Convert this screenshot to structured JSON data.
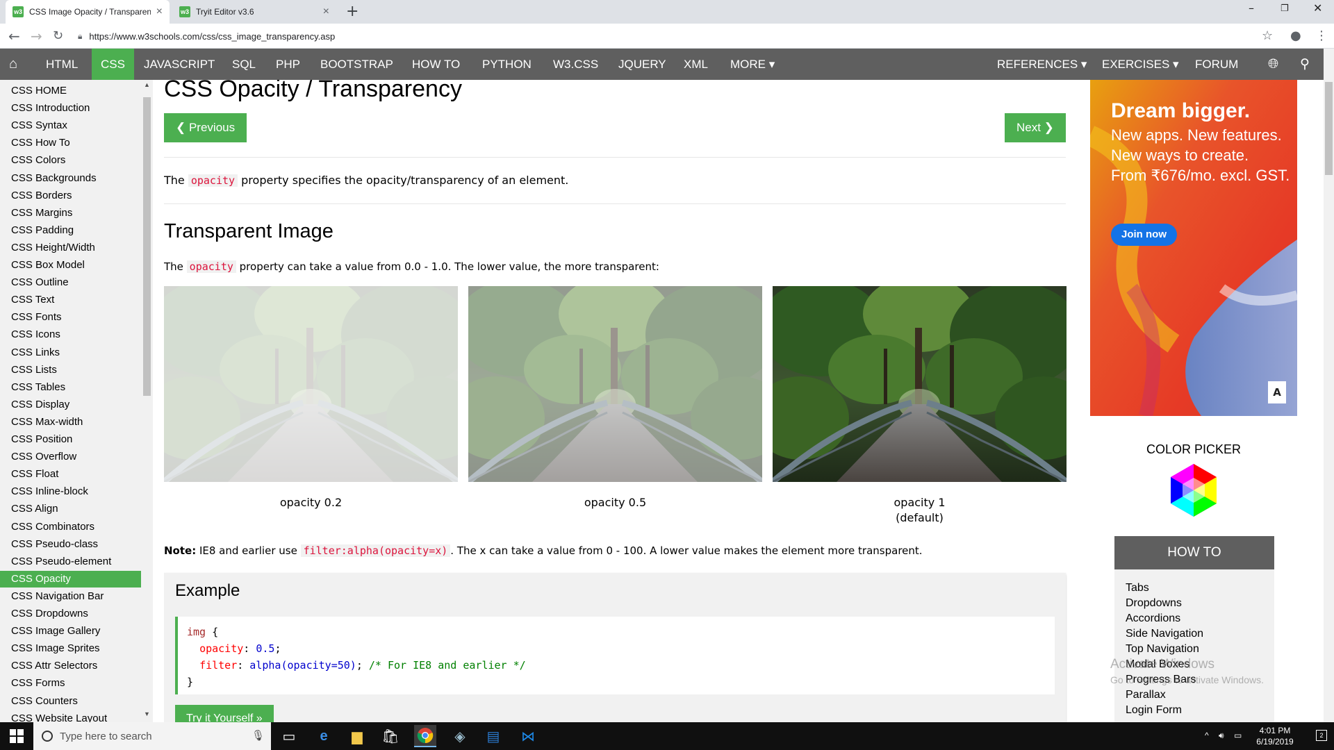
{
  "browser": {
    "tabs": [
      {
        "title": "CSS Image Opacity / Transparency",
        "favicon": "w3"
      },
      {
        "title": "Tryit Editor v3.6",
        "favicon": "w3"
      }
    ],
    "url": "https://www.w3schools.com/css/css_image_transparency.asp"
  },
  "w3nav": {
    "items": [
      "HTML",
      "CSS",
      "JAVASCRIPT",
      "SQL",
      "PHP",
      "BOOTSTRAP",
      "HOW TO",
      "PYTHON",
      "W3.CSS",
      "JQUERY",
      "XML",
      "MORE ▾"
    ],
    "right_items": [
      "REFERENCES ▾",
      "EXERCISES ▾",
      "FORUM"
    ],
    "active": "CSS",
    "accent": "#4caf50"
  },
  "sidebar": {
    "items": [
      "CSS HOME",
      "CSS Introduction",
      "CSS Syntax",
      "CSS How To",
      "CSS Colors",
      "CSS Backgrounds",
      "CSS Borders",
      "CSS Margins",
      "CSS Padding",
      "CSS Height/Width",
      "CSS Box Model",
      "CSS Outline",
      "CSS Text",
      "CSS Fonts",
      "CSS Icons",
      "CSS Links",
      "CSS Lists",
      "CSS Tables",
      "CSS Display",
      "CSS Max-width",
      "CSS Position",
      "CSS Overflow",
      "CSS Float",
      "CSS Inline-block",
      "CSS Align",
      "CSS Combinators",
      "CSS Pseudo-class",
      "CSS Pseudo-element",
      "CSS Opacity",
      "CSS Navigation Bar",
      "CSS Dropdowns",
      "CSS Image Gallery",
      "CSS Image Sprites",
      "CSS Attr Selectors",
      "CSS Forms",
      "CSS Counters",
      "CSS Website Layout"
    ],
    "active": "CSS Opacity"
  },
  "main": {
    "title": "CSS Opacity / Transparency",
    "prev_label": "❮ Previous",
    "next_label": "Next ❯",
    "intro": {
      "before": "The ",
      "code": "opacity",
      "after": " property specifies the opacity/transparency of an element."
    },
    "section_title": "Transparent Image",
    "section_text": {
      "before": "The ",
      "code": "opacity",
      "after": " property can take a value from 0.0 - 1.0. The lower value, the more transparent:"
    },
    "images": [
      {
        "opacity": 0.2,
        "caption": "opacity 0.2",
        "caption2": ""
      },
      {
        "opacity": 0.5,
        "caption": "opacity 0.5",
        "caption2": ""
      },
      {
        "opacity": 1,
        "caption": "opacity 1",
        "caption2": "(default)"
      }
    ],
    "note": {
      "label": "Note:",
      "before": " IE8 and earlier use ",
      "code": "filter:alpha(opacity=x)",
      "after": ". The x can take a value from 0 - 100. A lower value makes the element more transparent."
    },
    "example": {
      "heading": "Example",
      "code": {
        "selector": "img",
        "open_brace": " {",
        "prop1": "opacity",
        "val1": " 0.5",
        "prop2": "filter",
        "val2": " alpha(opacity=50)",
        "comment": "/* For IE8 and earlier */",
        "close_brace": "}"
      },
      "try_label": "Try it Yourself »"
    }
  },
  "ad": {
    "headline": "Dream bigger.",
    "lines": [
      "New apps. New features.",
      "New ways to create.",
      "From ₹676/mo. excl. GST."
    ],
    "cta": "Join now",
    "brand_icon": "adobe-icon"
  },
  "color_picker": {
    "title": "COLOR PICKER"
  },
  "howto": {
    "title": "HOW TO",
    "items": [
      "Tabs",
      "Dropdowns",
      "Accordions",
      "Side Navigation",
      "Top Navigation",
      "Modal Boxes",
      "Progress Bars",
      "Parallax",
      "Login Form"
    ]
  },
  "watermark": {
    "line1": "Activate Windows",
    "line2": "Go to Settings to activate Windows."
  },
  "taskbar": {
    "search_placeholder": "Type here to search",
    "time": "4:01 PM",
    "date": "6/19/2019",
    "notif_count": "2"
  }
}
